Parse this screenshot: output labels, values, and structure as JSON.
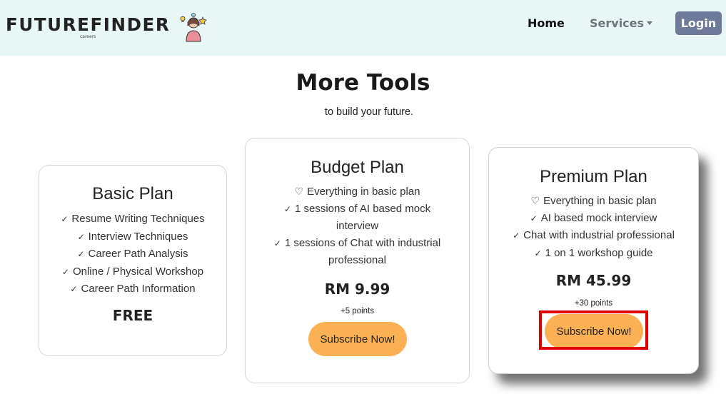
{
  "nav": {
    "brand": "FUTUREFINDER",
    "brand_sub": "careers",
    "home": "Home",
    "services": "Services",
    "login": "Login"
  },
  "header": {
    "title": "More Tools",
    "subtitle": "to build your future."
  },
  "plans": [
    {
      "name": "Basic Plan",
      "features": [
        "Resume Writing Techniques",
        "Interview Techniques",
        "Career Path Analysis",
        "Online / Physical Workshop",
        "Career Path Information"
      ],
      "price": "FREE"
    },
    {
      "name": "Budget Plan",
      "features": [
        "Everything in basic plan",
        "1 sessions of AI based mock",
        "interview",
        "1 sessions of Chat with industrial",
        "professional"
      ],
      "price": "RM 9.99",
      "points": "+5 points",
      "button": "Subscribe Now!"
    },
    {
      "name": "Premium Plan",
      "features": [
        "Everything in basic plan",
        "AI based mock interview",
        "Chat with industrial professional",
        "1 on 1 workshop guide"
      ],
      "price": "RM 45.99",
      "points": "+30 points",
      "button": "Subscribe Now!"
    }
  ],
  "colors": {
    "navbar_bg": "#e8f7f5",
    "login_bg": "#6d7a99",
    "subscribe_bg": "#fbb153",
    "highlight": "#e00000"
  }
}
